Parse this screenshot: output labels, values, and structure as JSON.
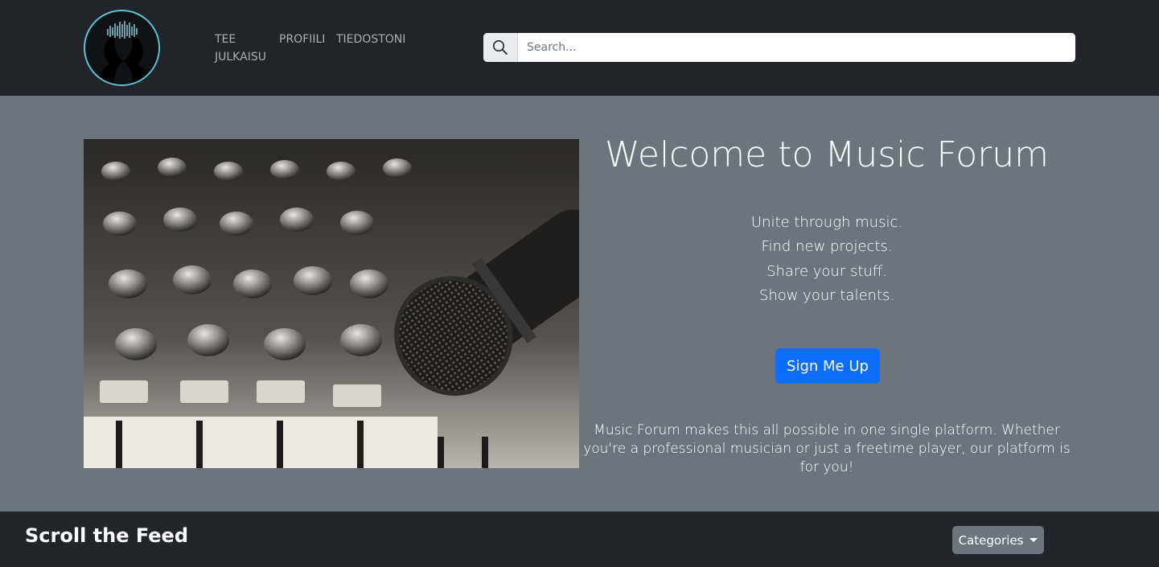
{
  "nav": {
    "logo_icon": "headphones-silhouette-logo",
    "links": [
      "TEE JULKAISU",
      "PROFIILI",
      "TIEDOSTONI"
    ]
  },
  "search": {
    "placeholder": "Search...",
    "value": "",
    "icon": "search-icon"
  },
  "hero": {
    "image_icon": "mixer-microphone-photo",
    "title": "Welcome to Music Forum",
    "taglines": [
      "Unite through music.",
      "Find new projects.",
      "Share your stuff.",
      "Show your talents."
    ],
    "signup_label": "Sign Me Up",
    "description": "Music Forum makes this all possible in one single platform. Whether you're a professional musician or just a freetime player, our platform is for you!"
  },
  "feed": {
    "title": "Scroll the Feed",
    "categories_label": "Categories"
  },
  "colors": {
    "navbar": "#212529",
    "hero_bg": "#6c757d",
    "primary": "#0d6efd",
    "logo_ring": "#5bc4cf"
  }
}
